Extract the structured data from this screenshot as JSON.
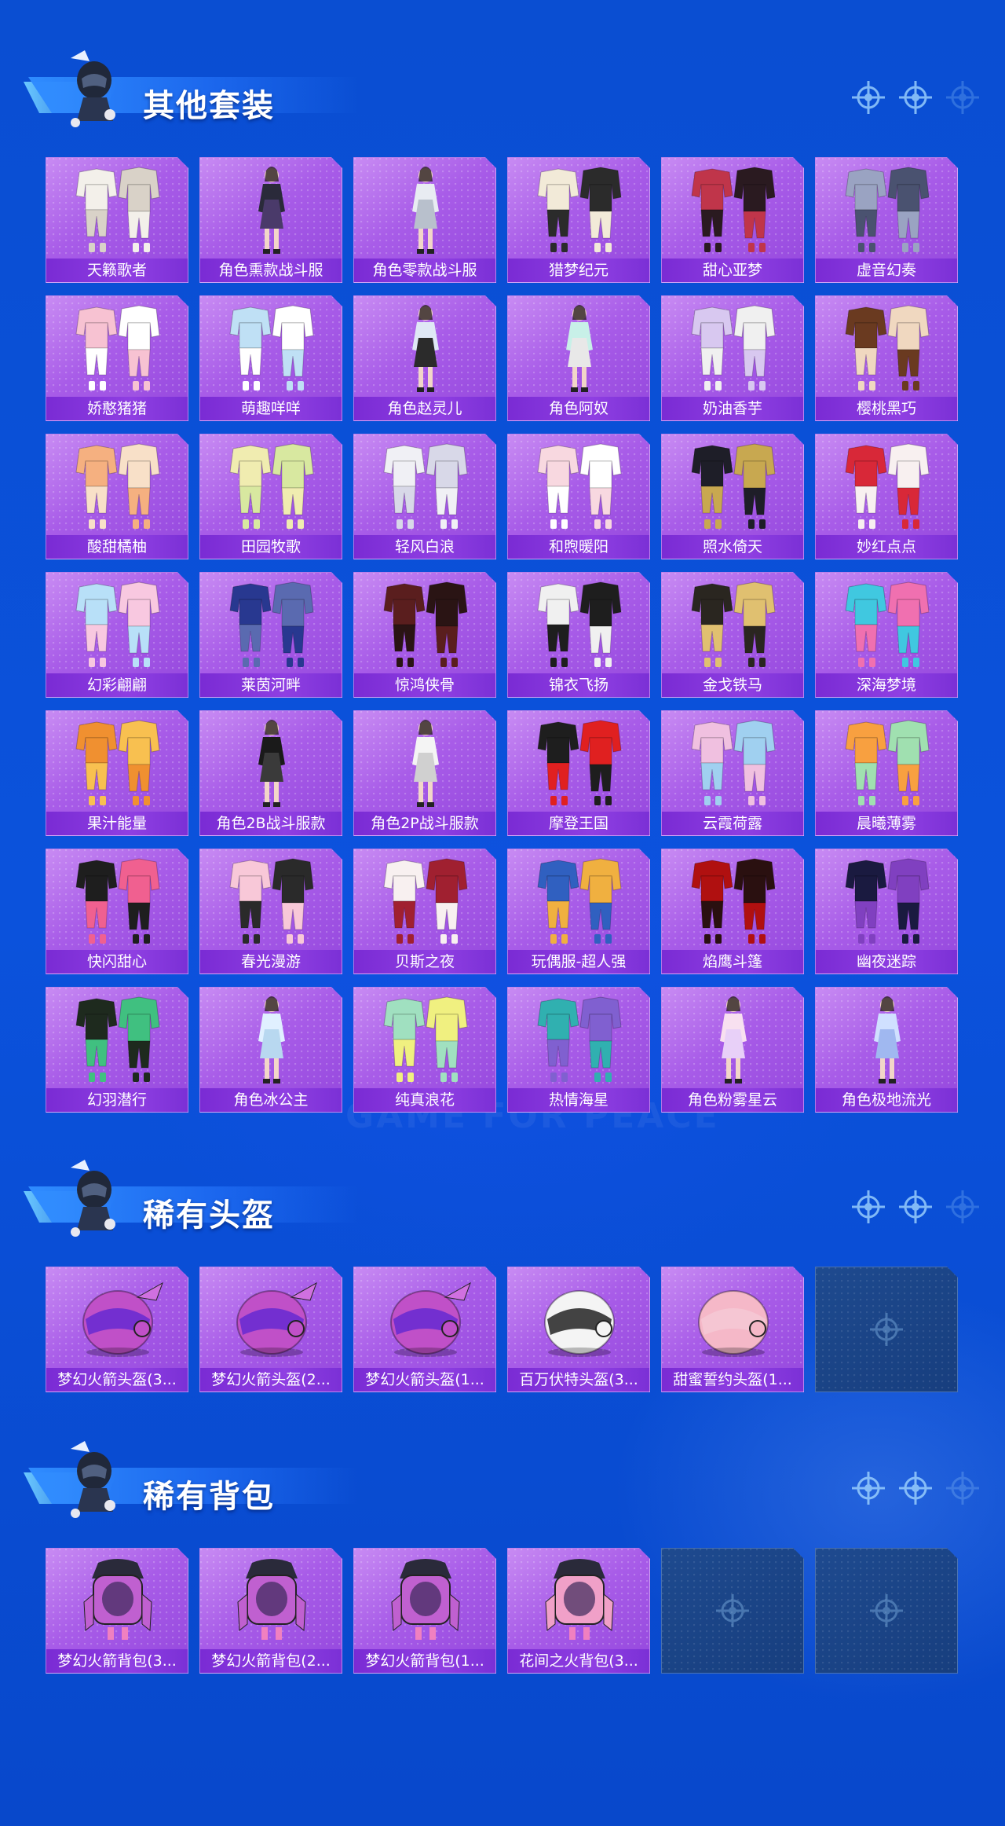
{
  "watermark": "GAME FOR PEACE",
  "colors": {
    "background": "#0a4fd6",
    "card": "#a85ce8",
    "card_label": "#7a2bd4",
    "empty_card": "#1e4a8f"
  },
  "sections": [
    {
      "title": "其他套装",
      "items": [
        {
          "label": "天籁歌者",
          "icon": "outfit-white-icon"
        },
        {
          "label": "角色熏款战斗服",
          "icon": "character-dark-suit-icon"
        },
        {
          "label": "角色零款战斗服",
          "icon": "character-white-suit-icon"
        },
        {
          "label": "猎梦纪元",
          "icon": "outfit-cowprint-icon"
        },
        {
          "label": "甜心亚梦",
          "icon": "outfit-red-black-icon"
        },
        {
          "label": "虚音幻奏",
          "icon": "outfit-grey-icon"
        },
        {
          "label": "娇憨猪猪",
          "icon": "outfit-pink-icon"
        },
        {
          "label": "萌趣咩咩",
          "icon": "outfit-lightblue-icon"
        },
        {
          "label": "角色赵灵儿",
          "icon": "character-blue-dress-icon"
        },
        {
          "label": "角色阿奴",
          "icon": "character-teal-dress-icon"
        },
        {
          "label": "奶油香芋",
          "icon": "outfit-lavender-icon"
        },
        {
          "label": "樱桃黑巧",
          "icon": "outfit-brown-icon"
        },
        {
          "label": "酸甜橘柚",
          "icon": "outfit-orange-icon"
        },
        {
          "label": "田园牧歌",
          "icon": "outfit-yellow-icon"
        },
        {
          "label": "轻风白浪",
          "icon": "outfit-white-lace-icon"
        },
        {
          "label": "和煦暖阳",
          "icon": "outfit-pink-white-icon"
        },
        {
          "label": "照水倚天",
          "icon": "outfit-black-gold-icon"
        },
        {
          "label": "妙红点点",
          "icon": "outfit-red-icon"
        },
        {
          "label": "幻彩翩翩",
          "icon": "outfit-pastel-icon"
        },
        {
          "label": "莱茵河畔",
          "icon": "outfit-navy-plaid-icon"
        },
        {
          "label": "惊鸿侠骨",
          "icon": "outfit-dark-red-icon"
        },
        {
          "label": "锦衣飞扬",
          "icon": "outfit-white-black-icon"
        },
        {
          "label": "金戈铁马",
          "icon": "outfit-gold-black-icon"
        },
        {
          "label": "深海梦境",
          "icon": "outfit-cyan-pink-icon"
        },
        {
          "label": "果汁能量",
          "icon": "outfit-orange-puffer-icon"
        },
        {
          "label": "角色2B战斗服款",
          "icon": "character-black-dress-icon"
        },
        {
          "label": "角色2P战斗服款",
          "icon": "character-white-dress-icon"
        },
        {
          "label": "摩登王国",
          "icon": "outfit-black-white-red-icon"
        },
        {
          "label": "云霞荷露",
          "icon": "outfit-gradient-dress-icon"
        },
        {
          "label": "晨曦薄雾",
          "icon": "outfit-orange-green-icon"
        },
        {
          "label": "快闪甜心",
          "icon": "outfit-black-pink-icon"
        },
        {
          "label": "春光漫游",
          "icon": "outfit-pink-jacket-icon"
        },
        {
          "label": "贝斯之夜",
          "icon": "outfit-white-red-icon"
        },
        {
          "label": "玩偶服-超人强",
          "icon": "outfit-mascot-icon"
        },
        {
          "label": "焰鹰斗篷",
          "icon": "outfit-red-cloak-icon"
        },
        {
          "label": "幽夜迷踪",
          "icon": "outfit-dark-blue-icon"
        },
        {
          "label": "幻羽潜行",
          "icon": "outfit-black-green-icon"
        },
        {
          "label": "角色冰公主",
          "icon": "character-ice-dress-icon"
        },
        {
          "label": "纯真浪花",
          "icon": "outfit-green-yellow-icon"
        },
        {
          "label": "热情海星",
          "icon": "outfit-teal-pattern-icon"
        },
        {
          "label": "角色粉雾星云",
          "icon": "character-pink-dress-icon"
        },
        {
          "label": "角色极地流光",
          "icon": "character-blue-gown-icon"
        }
      ]
    },
    {
      "title": "稀有头盔",
      "items": [
        {
          "label": "梦幻火箭头盔(3...",
          "icon": "helmet-rocket-3-icon"
        },
        {
          "label": "梦幻火箭头盔(2...",
          "icon": "helmet-rocket-2-icon"
        },
        {
          "label": "梦幻火箭头盔(1...",
          "icon": "helmet-rocket-1-icon"
        },
        {
          "label": "百万伏特头盔(3...",
          "icon": "helmet-volt-icon"
        },
        {
          "label": "甜蜜誓约头盔(1...",
          "icon": "helmet-pink-icon"
        },
        {
          "label": "",
          "icon": "empty-slot-icon",
          "empty": true
        }
      ]
    },
    {
      "title": "稀有背包",
      "items": [
        {
          "label": "梦幻火箭背包(3...",
          "icon": "backpack-rocket-3-icon"
        },
        {
          "label": "梦幻火箭背包(2...",
          "icon": "backpack-rocket-2-icon"
        },
        {
          "label": "梦幻火箭背包(1...",
          "icon": "backpack-rocket-1-icon"
        },
        {
          "label": "花间之火背包(3...",
          "icon": "backpack-flower-icon"
        },
        {
          "label": "",
          "icon": "empty-slot-icon",
          "empty": true
        },
        {
          "label": "",
          "icon": "empty-slot-icon",
          "empty": true
        }
      ]
    }
  ]
}
